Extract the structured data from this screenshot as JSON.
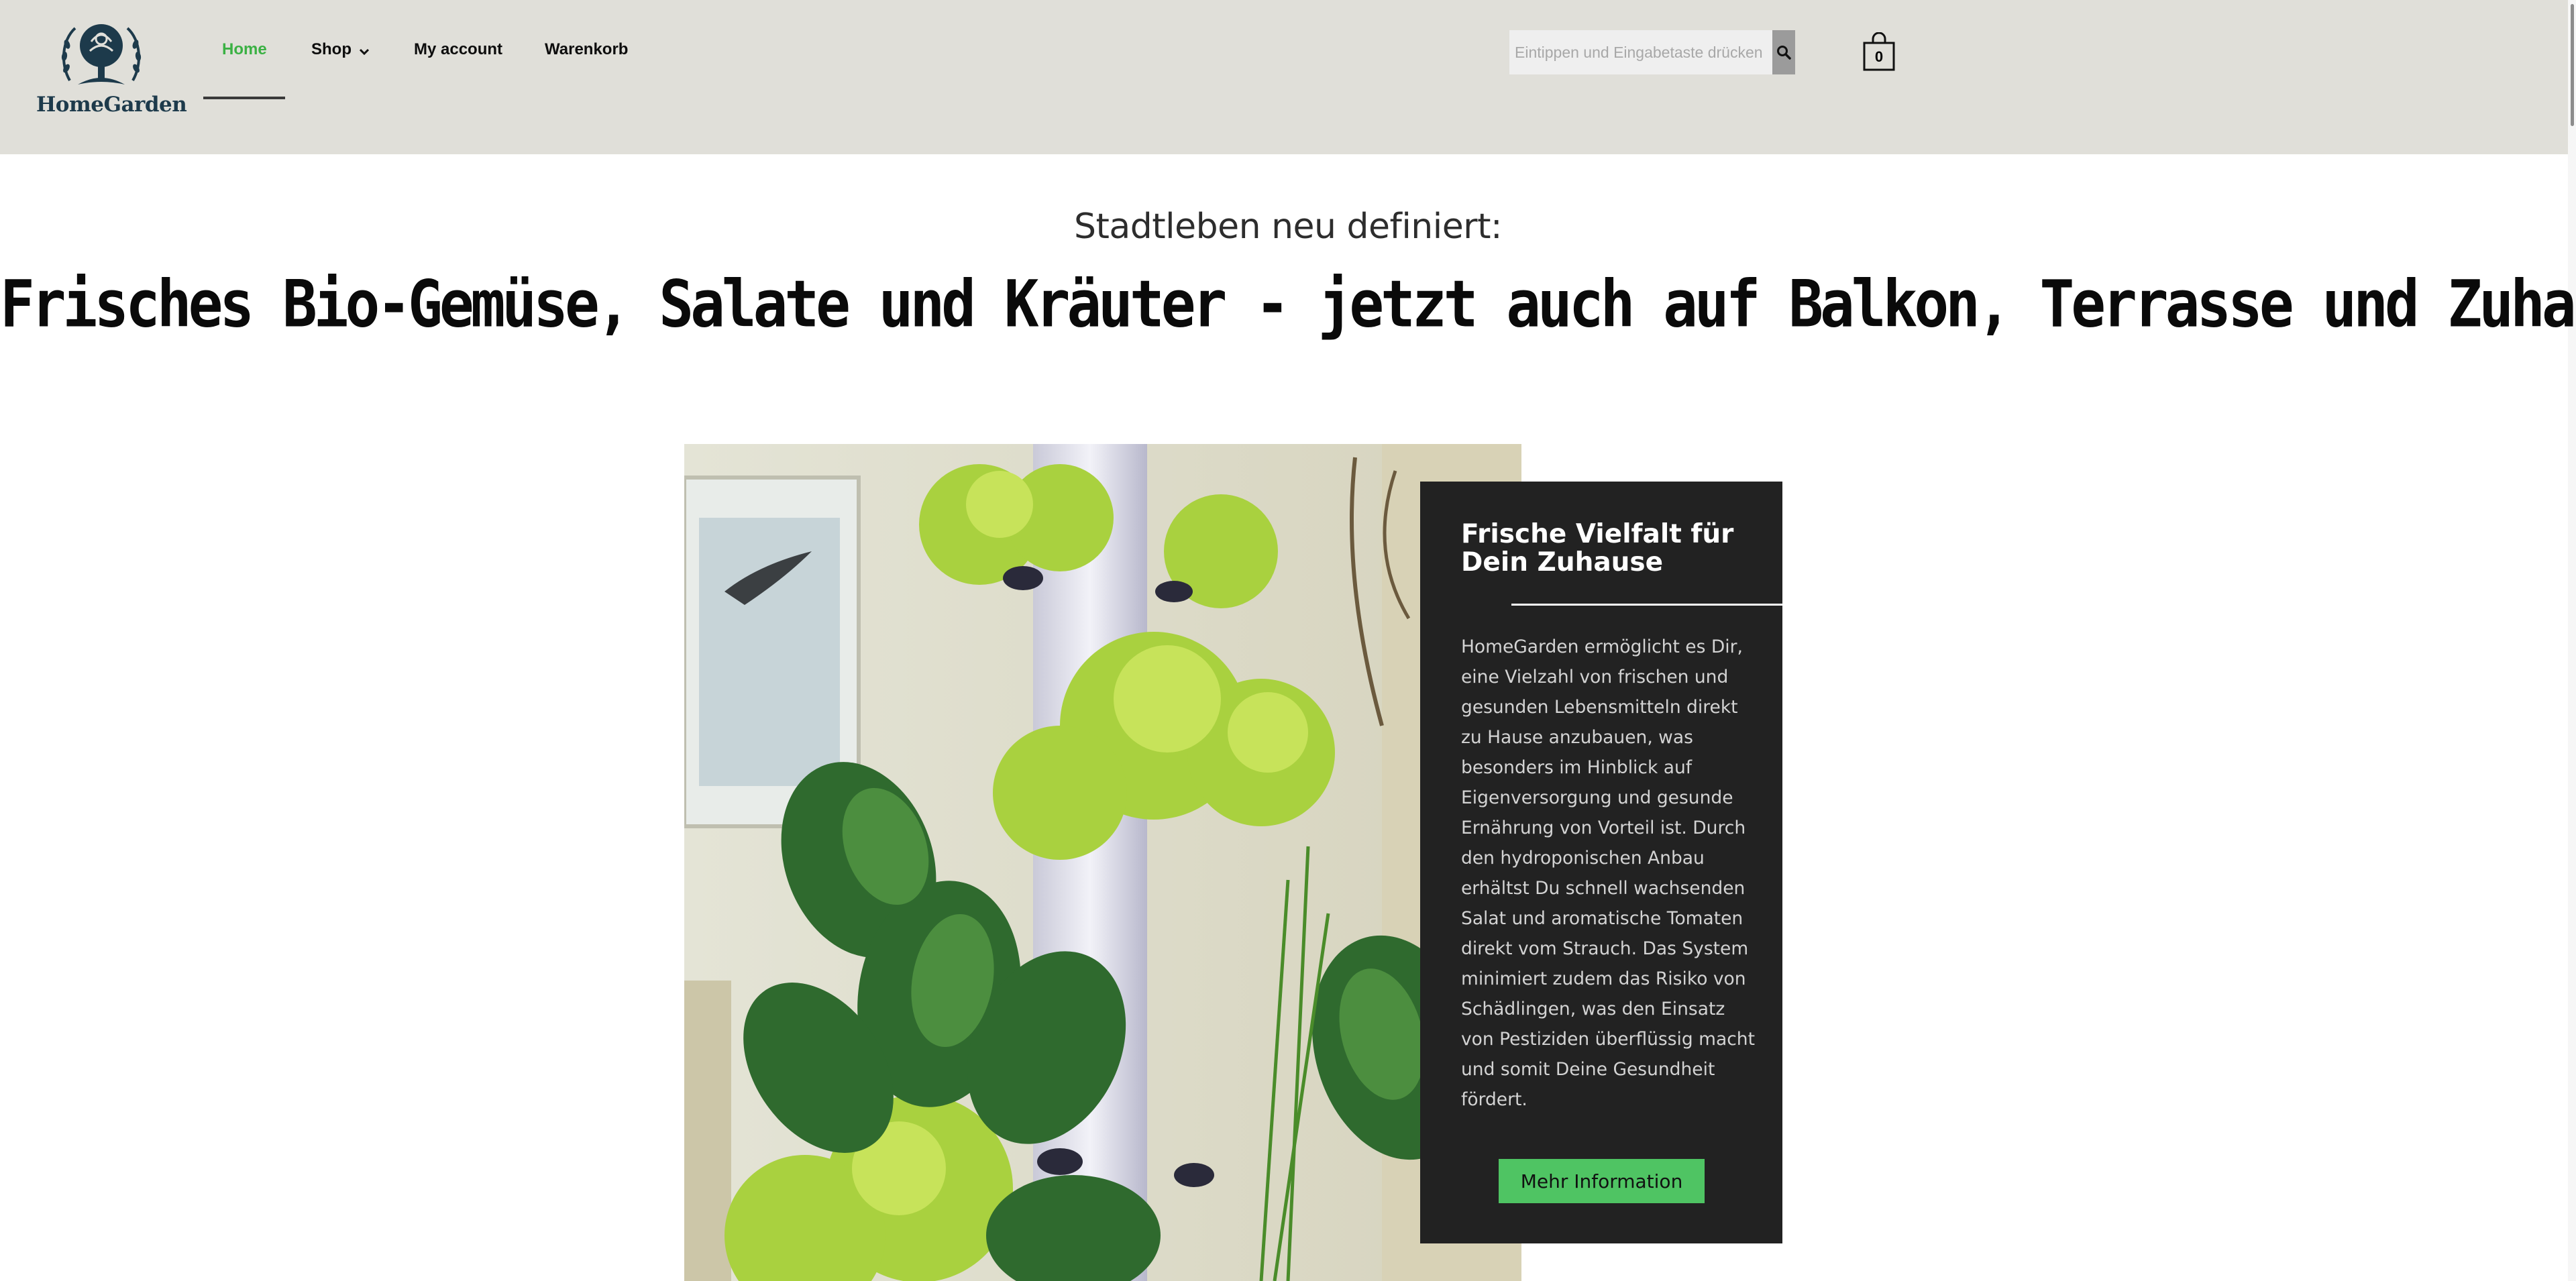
{
  "brand": {
    "name": "HomeGarden"
  },
  "nav": {
    "items": [
      {
        "label": "Home",
        "active": true
      },
      {
        "label": "Shop",
        "has_dropdown": true
      },
      {
        "label": "My account"
      },
      {
        "label": "Warenkorb"
      }
    ]
  },
  "search": {
    "placeholder": "Eintippen und Eingabetaste drücken"
  },
  "cart": {
    "count": "0"
  },
  "hero": {
    "subtitle": "Stadtleben neu definiert:",
    "headline": "Frisches Bio-Gemüse, Salate und Kräuter - jetzt auch auf Balkon, Terrasse und Zuhause."
  },
  "card": {
    "title": "Frische Vielfalt für Dein Zuhause",
    "body": "HomeGarden ermöglicht es Dir, eine Vielzahl von frischen und gesunden Lebensmitteln direkt zu Hause anzubauen, was besonders im Hinblick auf Eigenversorgung und gesunde Ernährung von Vorteil ist. Durch den hydroponischen Anbau erhältst Du schnell wachsenden Salat und aromatische Tomaten direkt vom Strauch. Das System minimiert zudem das Risiko von Schädlingen, was den Einsatz von Pestiziden überflüssig macht und somit Deine Gesundheit fördert.",
    "button": "Mehr Information"
  },
  "colors": {
    "header_bg": "#e0dfd9",
    "accent_green": "#3bb144",
    "button_green": "#4fc463",
    "card_bg": "#222222",
    "brand_navy": "#1d3a4b"
  }
}
